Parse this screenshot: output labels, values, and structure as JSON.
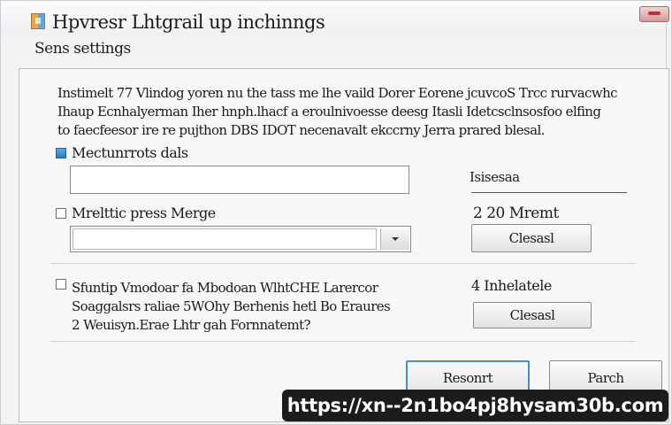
{
  "window": {
    "title": "Hpvresr Lhtgrail up inchinngs",
    "section_label": "Sens settings"
  },
  "description": {
    "lines": [
      "Instimelt 77 Vlindog yoren nu the tass me lhe vaild Dorer Eorene jcuvcoS Trcc rurvacwhc",
      "Ihaup Ecnhalyerman Iher hnph.lhacf a eroulnivoesse deesg Itasli Idetcsclnsosfoo elfing",
      "to faecfeesor ire re pujthon DBS IDOT necenavalt ekccrny Jerra prared blesal."
    ]
  },
  "option1": {
    "label": "Mectunrrots dals",
    "checked": true,
    "input_value": ""
  },
  "right_panel1": {
    "label": "Isisesaa"
  },
  "option2": {
    "label": "Mrelttic press Merge",
    "checked": false,
    "combo_value": ""
  },
  "right_panel2": {
    "value": "2 20 Mremt",
    "button_label": "Clesasl"
  },
  "option3": {
    "lines": [
      "Sfuntip Vmodoar fa Mbodoan WlhtCHE Larercor",
      "Soaggalsrs raliae 5WOhy Berhenis hetl Bo Eraures",
      "2 Weuisyn.Erae Lhtr gah Fornnatemt?"
    ],
    "checked": false
  },
  "right_panel3": {
    "label": "4 Inhelatele",
    "button_label": "Clesasl"
  },
  "footer": {
    "primary_button": "Resonrt",
    "secondary_button": "Parch"
  },
  "watermark": {
    "text": "https://xn--2n1bo4pj8hysam30b.com"
  },
  "colors": {
    "accent": "#3e8fd6",
    "checkbox_checked": "#2d79c4"
  }
}
